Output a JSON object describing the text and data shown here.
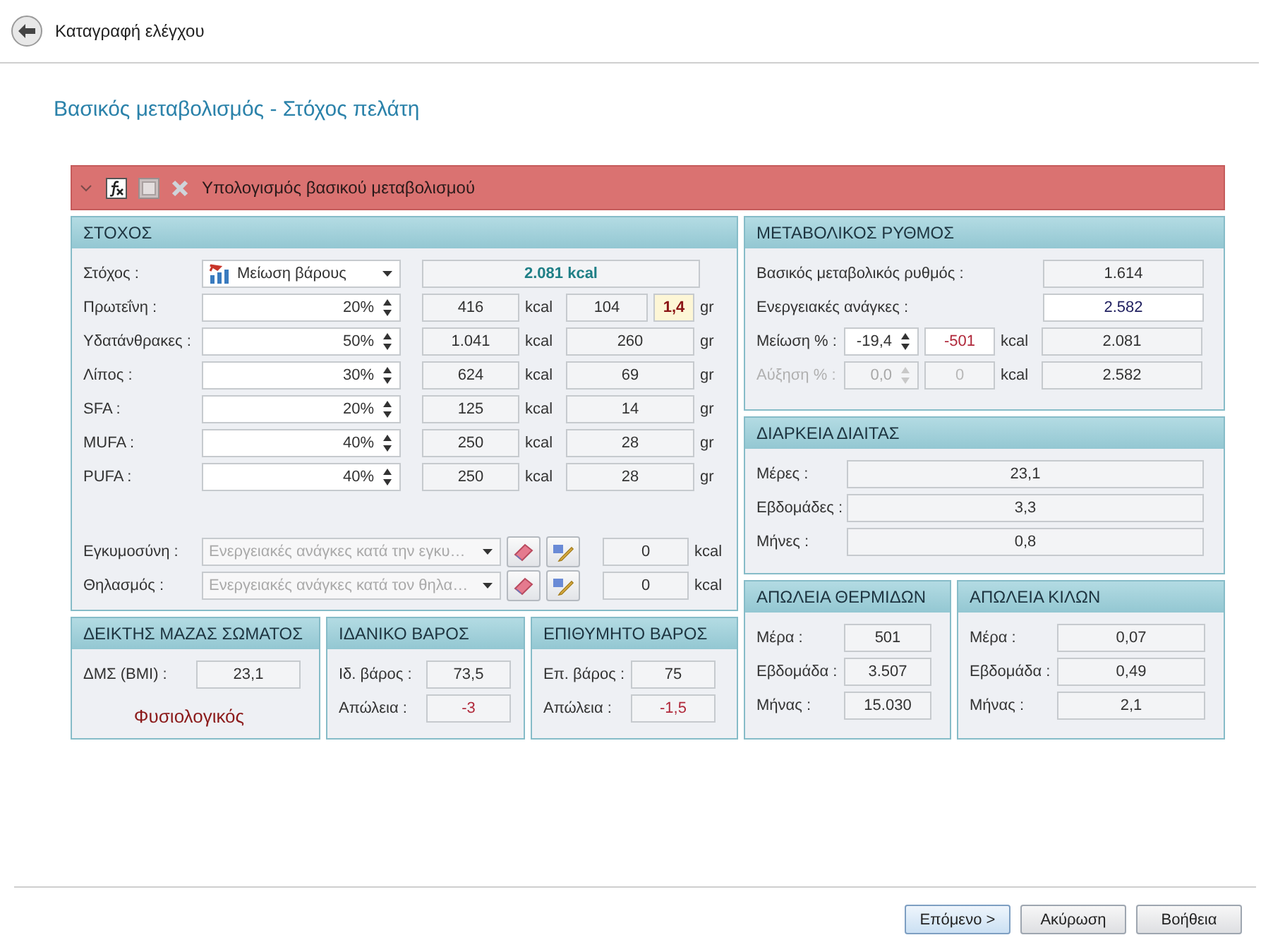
{
  "header": {
    "title": "Καταγραφή ελέγχου"
  },
  "page_title": "Βασικός μεταβολισμός - Στόχος πελάτη",
  "calc_bar": {
    "title": "Υπολογισμός βασικού μεταβολισμού",
    "expanded": true
  },
  "goal_panel": {
    "title": "ΣΤΟΧΟΣ",
    "goal": {
      "label": "Στόχος :",
      "value": "Μείωση βάρους",
      "total": "2.081 kcal"
    },
    "macros": [
      {
        "label": "Πρωτεΐνη :",
        "percent": "20%",
        "kcal": "416",
        "kcal_unit": "kcal",
        "grams": "104",
        "ratio": "1,4",
        "gram_unit": "gr"
      },
      {
        "label": "Υδατάνθρακες :",
        "percent": "50%",
        "kcal": "1.041",
        "kcal_unit": "kcal",
        "grams": "260",
        "gram_unit": "gr"
      },
      {
        "label": "Λίπος :",
        "percent": "30%",
        "kcal": "624",
        "kcal_unit": "kcal",
        "grams": "69",
        "gram_unit": "gr"
      },
      {
        "label": "SFA :",
        "percent": "20%",
        "kcal": "125",
        "kcal_unit": "kcal",
        "grams": "14",
        "gram_unit": "gr"
      },
      {
        "label": "MUFA :",
        "percent": "40%",
        "kcal": "250",
        "kcal_unit": "kcal",
        "grams": "28",
        "gram_unit": "gr"
      },
      {
        "label": "PUFA :",
        "percent": "40%",
        "kcal": "250",
        "kcal_unit": "kcal",
        "grams": "28",
        "gram_unit": "gr"
      }
    ],
    "extras": [
      {
        "label": "Εγκυμοσύνη :",
        "placeholder": "Ενεργειακές ανάγκες κατά την εγκυ…",
        "kcal": "0",
        "unit": "kcal"
      },
      {
        "label": "Θηλασμός :",
        "placeholder": "Ενεργειακές ανάγκες κατά τον θηλα…",
        "kcal": "0",
        "unit": "kcal"
      }
    ]
  },
  "body_panels": [
    {
      "title": "ΔΕΙΚΤΗΣ ΜΑΖΑΣ ΣΩΜΑΤΟΣ",
      "rows": [
        {
          "label": "ΔΜΣ (BMI) :",
          "value": "23,1",
          "alert": false
        }
      ],
      "status": "Φυσιολογικός"
    },
    {
      "title": "ΙΔΑΝΙΚΟ ΒΑΡΟΣ",
      "rows": [
        {
          "label": "Ιδ. βάρος :",
          "value": "73,5",
          "alert": false
        },
        {
          "label": "Απώλεια :",
          "value": "-3",
          "alert": true
        }
      ]
    },
    {
      "title": "ΕΠΙΘΥΜΗΤΟ ΒΑΡΟΣ",
      "rows": [
        {
          "label": "Επ. βάρος :",
          "value": "75",
          "alert": false
        },
        {
          "label": "Απώλεια :",
          "value": "-1,5",
          "alert": true
        }
      ]
    }
  ],
  "metabolic_panel": {
    "title": "ΜΕΤΑΒΟΛΙΚΟΣ ΡΥΘΜΟΣ",
    "rows": [
      {
        "kind": "value",
        "label": "Βασικός μεταβολικός ρυθμός :",
        "value": "1.614",
        "editable": false
      },
      {
        "kind": "value",
        "label": "Ενεργειακές ανάγκες :",
        "value": "2.582",
        "editable": true
      },
      {
        "kind": "adjust",
        "label": "Μείωση % :",
        "percent": "-19,4",
        "kcal": "-501",
        "unit": "kcal",
        "result": "2.081",
        "disabled": false,
        "alert": true
      },
      {
        "kind": "adjust",
        "label": "Αύξηση % :",
        "percent": "0,0",
        "kcal": "0",
        "unit": "kcal",
        "result": "2.582",
        "disabled": true,
        "alert": false
      }
    ]
  },
  "duration_panel": {
    "title": "ΔΙΑΡΚΕΙΑ ΔΙΑΙΤΑΣ",
    "rows": [
      {
        "label": "Μέρες :",
        "value": "23,1",
        "alert": false
      },
      {
        "label": "Εβδομάδες :",
        "value": "3,3",
        "alert": false
      },
      {
        "label": "Μήνες :",
        "value": "0,8",
        "alert": false
      }
    ]
  },
  "loss_panels": [
    {
      "title": "ΑΠΩΛΕΙΑ ΘΕΡΜΙΔΩΝ",
      "rows": [
        {
          "label": "Μέρα :",
          "value": "501",
          "alert": false
        },
        {
          "label": "Εβδομάδα :",
          "value": "3.507",
          "alert": false
        },
        {
          "label": "Μήνας :",
          "value": "15.030",
          "alert": false
        }
      ]
    },
    {
      "title": "ΑΠΩΛΕΙΑ ΚΙΛΩΝ",
      "rows": [
        {
          "label": "Μέρα :",
          "value": "0,07",
          "alert": false
        },
        {
          "label": "Εβδομάδα :",
          "value": "0,49",
          "alert": false
        },
        {
          "label": "Μήνας :",
          "value": "2,1",
          "alert": false
        }
      ]
    }
  ],
  "buttons": [
    {
      "label": "Επόμενο >",
      "default": true
    },
    {
      "label": "Ακύρωση",
      "default": false
    },
    {
      "label": "Βοήθεια",
      "default": false
    }
  ]
}
